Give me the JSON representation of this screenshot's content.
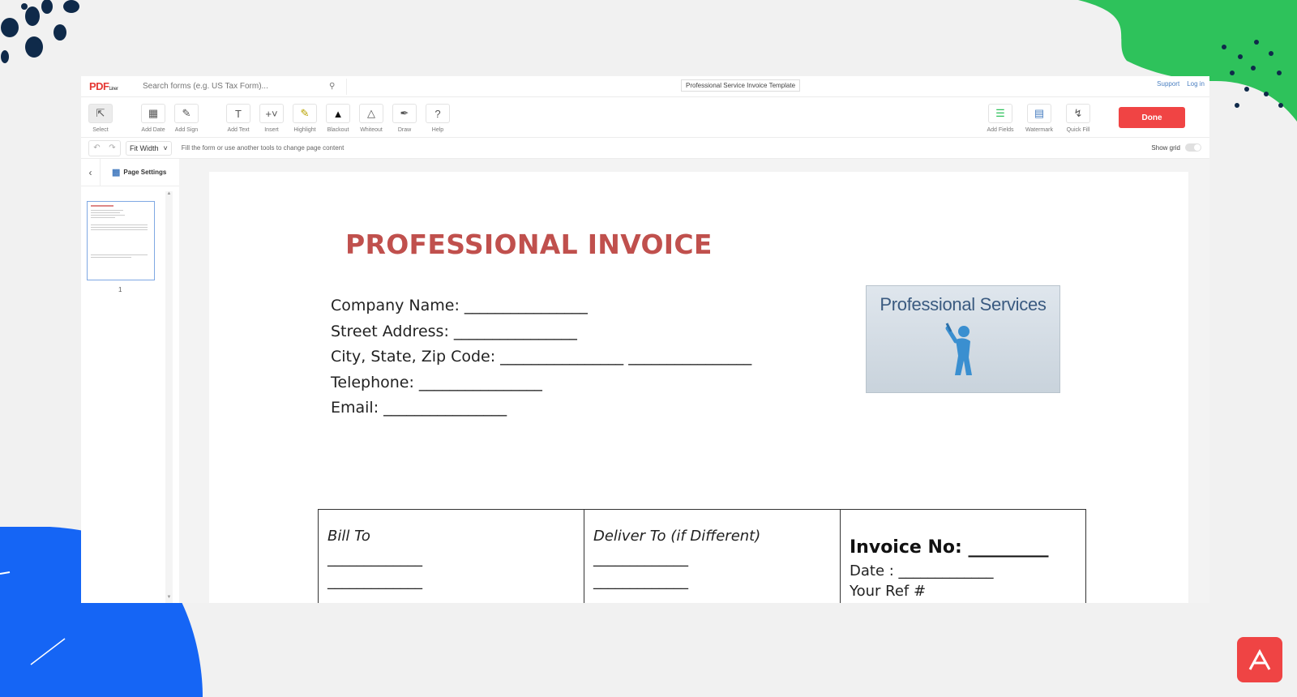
{
  "app": {
    "logo_main": "PDF",
    "logo_sub": "Liner",
    "search_placeholder": "Search forms (e.g. US Tax Form)...",
    "document_title": "Professional Service Invoice Template",
    "links": {
      "support": "Support",
      "login": "Log in"
    }
  },
  "toolbar": {
    "tools": [
      {
        "label": "Select",
        "icon": "cursor-icon"
      },
      {
        "label": "Add Date",
        "icon": "calendar-icon"
      },
      {
        "label": "Add Sign",
        "icon": "pen-sign-icon"
      },
      {
        "label": "Add Text",
        "icon": "text-icon"
      },
      {
        "label": "Insert",
        "icon": "plus-icon"
      },
      {
        "label": "Highlight",
        "icon": "highlighter-icon"
      },
      {
        "label": "Blackout",
        "icon": "blackout-icon"
      },
      {
        "label": "Whiteout",
        "icon": "eraser-icon"
      },
      {
        "label": "Draw",
        "icon": "draw-icon"
      },
      {
        "label": "Help",
        "icon": "help-icon"
      }
    ],
    "right_tools": [
      {
        "label": "Add Fields",
        "icon": "fields-icon"
      },
      {
        "label": "Watermark",
        "icon": "watermark-icon"
      },
      {
        "label": "Quick Fill",
        "icon": "lightning-icon"
      }
    ],
    "done_label": "Done"
  },
  "subbar": {
    "zoom": "Fit Width",
    "hint": "Fill the form or use another tools to change page content",
    "show_grid_label": "Show grid",
    "show_grid_on": false
  },
  "sidebar": {
    "page_settings_label": "Page Settings",
    "thumb_page_number": "1"
  },
  "document": {
    "title": "PROFESSIONAL INVOICE",
    "fields": [
      "Company Name: ________________",
      "Street Address: ________________",
      "City, State, Zip Code: ________________ ________________",
      "Telephone: ________________",
      "Email: ________________"
    ],
    "logo_text": "Professional Services",
    "table": {
      "bill_to": "Bill To",
      "deliver_to": "Deliver To (if Different)",
      "blank_line": "_____________",
      "invoice_no": "Invoice No: _________",
      "date": "Date : _____________",
      "your_ref": "Your Ref #"
    }
  },
  "colors": {
    "accent_red": "#f04444",
    "title_red": "#c0504d",
    "deco_green": "#2ec25b",
    "deco_blue": "#1565f5",
    "deco_navy": "#0f2a4a"
  }
}
